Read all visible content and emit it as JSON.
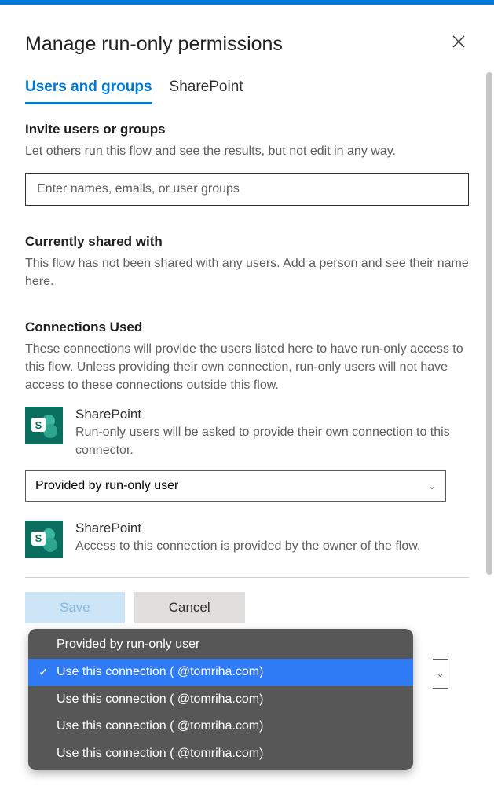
{
  "header": {
    "title": "Manage run-only permissions"
  },
  "tabs": {
    "users": "Users and groups",
    "sharepoint": "SharePoint"
  },
  "invite": {
    "title": "Invite users or groups",
    "desc": "Let others run this flow and see the results, but not edit in any way.",
    "placeholder": "Enter names, emails, or user groups"
  },
  "shared": {
    "title": "Currently shared with",
    "desc": "This flow has not been shared with any users. Add a person and see their name here."
  },
  "connections": {
    "title": "Connections Used",
    "desc": "These connections will provide the users listed here to have run-only access to this flow. Unless providing their own connection, run-only users will not have access to these connections outside this flow.",
    "items": [
      {
        "name": "SharePoint",
        "desc": "Run-only users will be asked to provide their own connection to this connector.",
        "selectValue": "Provided by run-only user"
      },
      {
        "name": "SharePoint",
        "desc": "Access to this connection is provided by the owner of the flow."
      }
    ]
  },
  "dropdown": {
    "options": [
      "Provided by run-only user",
      "Use this connection (       @tomriha.com)",
      "Use this connection (       @tomriha.com)",
      "Use this connection (       @tomriha.com)",
      "Use this connection (       @tomriha.com)"
    ],
    "selectedIndex": 1
  },
  "footer": {
    "save": "Save",
    "cancel": "Cancel"
  }
}
